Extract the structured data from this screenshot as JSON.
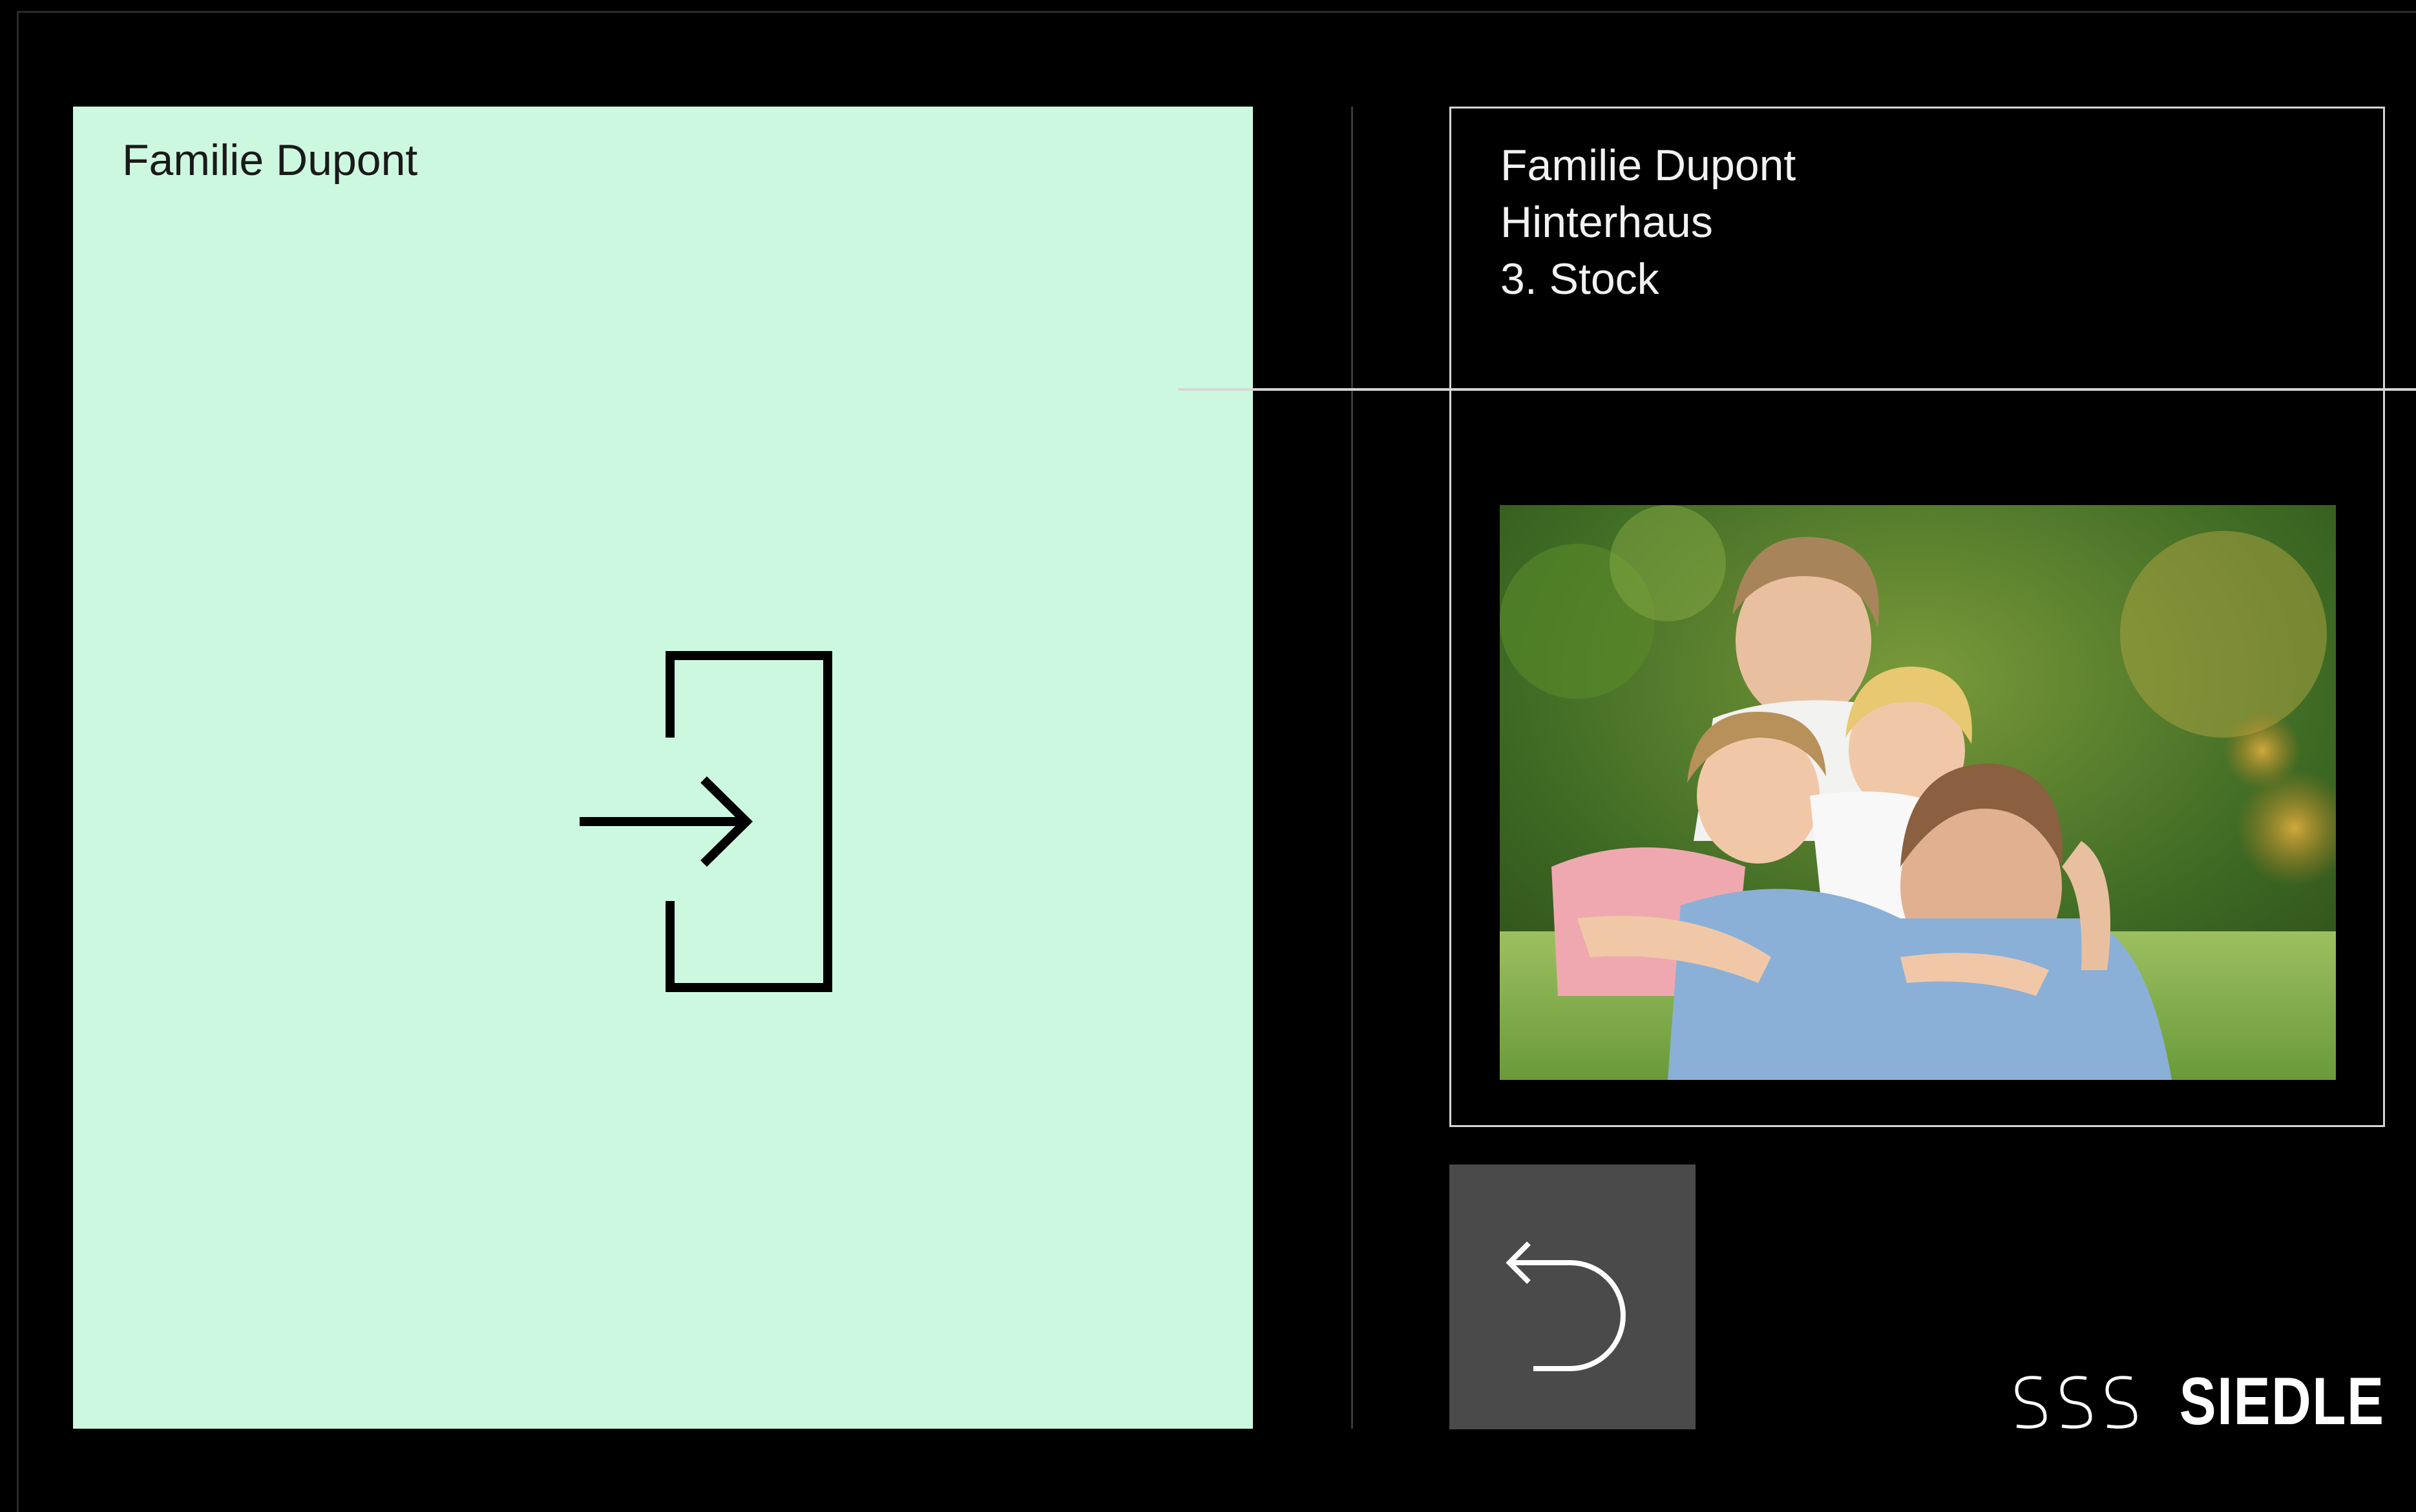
{
  "enter_panel": {
    "label": "Familie Dupont",
    "icon": "enter-door-icon",
    "background_color": "#cdf8e0"
  },
  "info_card": {
    "lines": [
      "Familie Dupont",
      "Hinterhaus",
      "3. Stock"
    ],
    "photo": "family-photo"
  },
  "back_button": {
    "icon": "back-arrow-icon",
    "background_color": "#4a4a4a"
  },
  "logo": {
    "mark": "SSS",
    "text": "SIEDLE"
  }
}
